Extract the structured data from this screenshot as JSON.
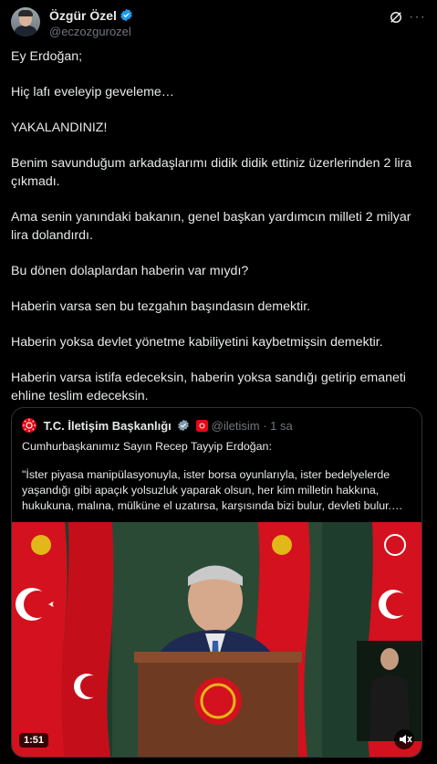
{
  "author": {
    "name": "Özgür Özel",
    "handle": "@eczozgurozel"
  },
  "tweet_paragraphs": [
    "Ey Erdoğan;",
    "Hiç lafı eveleyip geveleme…",
    "YAKALANDINIZ!",
    "Benim savunduğum arkadaşlarımı didik didik ettiniz üzerlerinden 2 lira çıkmadı.",
    "Ama senin yanındaki bakanın, genel başkan yardımcın milleti 2 milyar lira dolandırdı.",
    "Bu dönen dolaplardan haberin var mıydı?",
    "Haberin varsa sen bu tezgahın başındasın demektir.",
    "Haberin yoksa devlet yönetme kabiliyetini kaybetmişsin demektir.",
    "Haberin varsa istifa edeceksin, haberin yoksa sandığı getirip emaneti ehline teslim edeceksin."
  ],
  "quote": {
    "name": "T.C. İletişim Başkanlığı",
    "handle": "@iletisim",
    "separator": "·",
    "time": "1 sa",
    "line1": "Cumhurbaşkanımız Sayın Recep Tayyip Erdoğan:",
    "line2": "\"İster piyasa manipülasyonuyla, ister borsa oyunlarıyla, ister bedelyelerde yaşandığı gibi apaçık yolsuzluk yaparak olsun, her kim milletin hakkına, hukukuna, malına, mülküne el uzatırsa, karşısında bizi bulur, devleti bulur.…",
    "video_duration": "1:51"
  },
  "colors": {
    "accent": "#1d9bf0",
    "flag_red": "#e30a17",
    "verified": "#1d9bf0",
    "gold_badge": "#e2b719"
  },
  "icons": [
    "verified-badge-icon",
    "grok-icon",
    "more-icon",
    "mute-icon"
  ]
}
